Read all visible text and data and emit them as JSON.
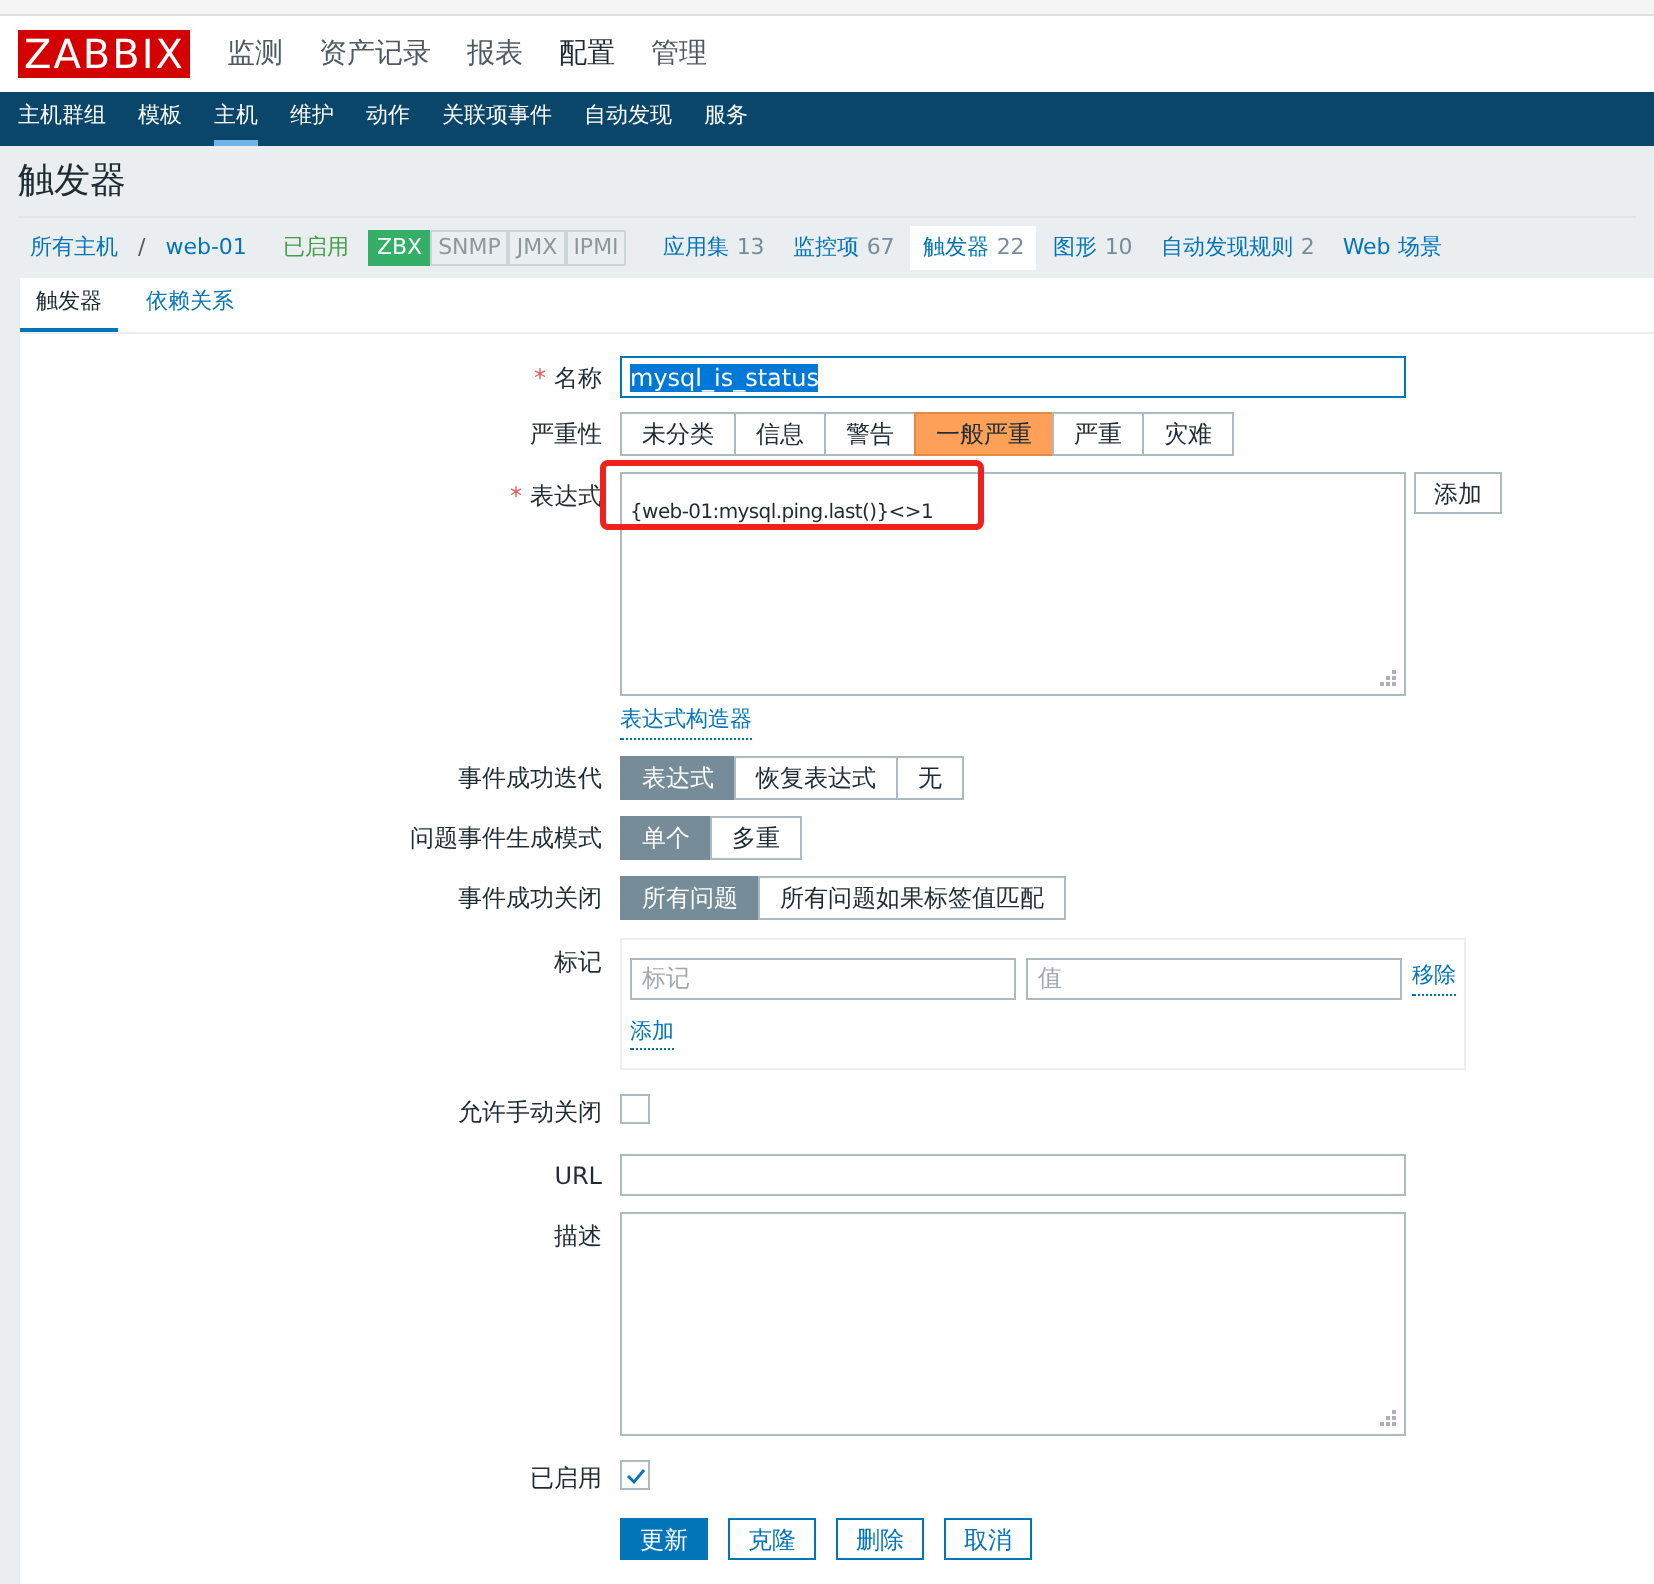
{
  "logo": "ZABBIX",
  "main_menu": [
    {
      "label": "监测",
      "selected": false
    },
    {
      "label": "资产记录",
      "selected": false
    },
    {
      "label": "报表",
      "selected": false
    },
    {
      "label": "配置",
      "selected": true
    },
    {
      "label": "管理",
      "selected": false
    }
  ],
  "sub_menu": [
    {
      "label": "主机群组",
      "selected": false
    },
    {
      "label": "模板",
      "selected": false
    },
    {
      "label": "主机",
      "selected": true
    },
    {
      "label": "维护",
      "selected": false
    },
    {
      "label": "动作",
      "selected": false
    },
    {
      "label": "关联项事件",
      "selected": false
    },
    {
      "label": "自动发现",
      "selected": false
    },
    {
      "label": "服务",
      "selected": false
    }
  ],
  "page_title": "触发器",
  "breadcrumb": {
    "items": [
      "所有主机",
      "web-01"
    ],
    "separator": "/",
    "status": "已启用",
    "availability": [
      {
        "label": "ZBX",
        "on": true
      },
      {
        "label": "SNMP",
        "on": false
      },
      {
        "label": "JMX",
        "on": false
      },
      {
        "label": "IPMI",
        "on": false
      }
    ],
    "links": [
      {
        "label": "应用集",
        "count": "13",
        "selected": false
      },
      {
        "label": "监控项",
        "count": "67",
        "selected": false
      },
      {
        "label": "触发器",
        "count": "22",
        "selected": true
      },
      {
        "label": "图形",
        "count": "10",
        "selected": false
      },
      {
        "label": "自动发现规则",
        "count": "2",
        "selected": false
      },
      {
        "label": "Web 场景",
        "selected": false
      }
    ]
  },
  "tabs": [
    {
      "label": "触发器",
      "selected": true
    },
    {
      "label": "依赖关系",
      "selected": false
    }
  ],
  "fields": [
    {
      "kind": "text",
      "label": "名称",
      "required": "*",
      "value": "mysql_is_status"
    },
    {
      "kind": "segmented",
      "label": "严重性",
      "options": [
        {
          "label": "未分类",
          "selected": false
        },
        {
          "label": "信息",
          "selected": false
        },
        {
          "label": "警告",
          "selected": false
        },
        {
          "label": "一般严重",
          "selected": true
        },
        {
          "label": "严重",
          "selected": false
        },
        {
          "label": "灾难",
          "selected": false
        }
      ]
    },
    {
      "kind": "expression",
      "label": "表达式",
      "required": "*",
      "value": "{web-01:mysql.ping.last()}<>1",
      "button": "添加",
      "link": "表达式构造器"
    },
    {
      "kind": "segmented",
      "label": "事件成功迭代",
      "options": [
        {
          "label": "表达式",
          "selected": true
        },
        {
          "label": "恢复表达式",
          "selected": false
        },
        {
          "label": "无",
          "selected": false
        }
      ]
    },
    {
      "kind": "segmented",
      "label": "问题事件生成模式",
      "options": [
        {
          "label": "单个",
          "selected": true
        },
        {
          "label": "多重",
          "selected": false
        }
      ]
    },
    {
      "kind": "segmented",
      "label": "事件成功关闭",
      "options": [
        {
          "label": "所有问题",
          "selected": true
        },
        {
          "label": "所有问题如果标签值匹配",
          "selected": false
        }
      ]
    },
    {
      "kind": "tags",
      "label": "标记",
      "tag_placeholder": "标记",
      "value_placeholder": "值",
      "remove": "移除",
      "add": "添加"
    },
    {
      "kind": "checkbox",
      "label": "允许手动关闭",
      "checked": false
    },
    {
      "kind": "text",
      "label": "URL"
    },
    {
      "kind": "textarea",
      "label": "描述"
    },
    {
      "kind": "checkbox",
      "label": "已启用",
      "checked": true
    }
  ],
  "buttons": [
    {
      "label": "更新",
      "primary": true
    },
    {
      "label": "克隆",
      "primary": false
    },
    {
      "label": "删除",
      "primary": false
    },
    {
      "label": "取消",
      "primary": false
    }
  ]
}
